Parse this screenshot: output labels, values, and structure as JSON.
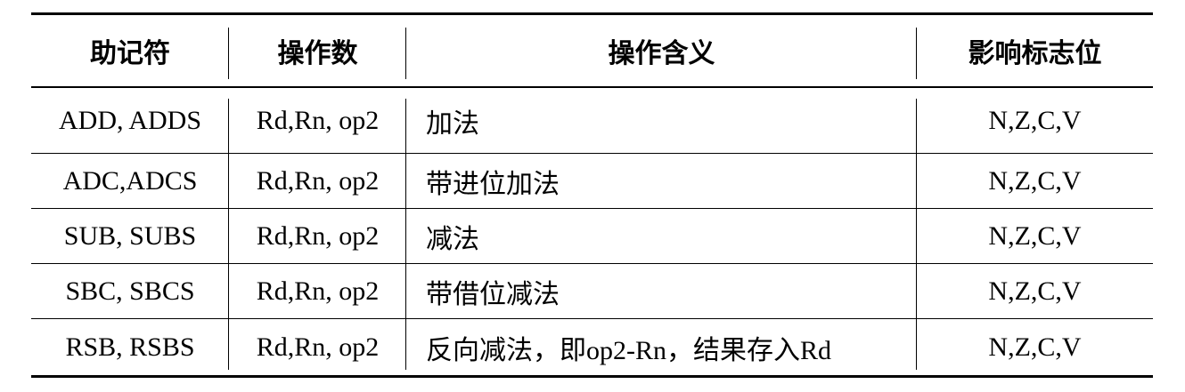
{
  "table": {
    "headers": [
      "助记符",
      "操作数",
      "操作含义",
      "影响标志位"
    ],
    "rows": [
      [
        "ADD, ADDS",
        "Rd,Rn, op2",
        "加法",
        "N,Z,C,V"
      ],
      [
        "ADC,ADCS",
        "Rd,Rn, op2",
        "带进位加法",
        "N,Z,C,V"
      ],
      [
        "SUB, SUBS",
        "Rd,Rn, op2",
        "减法",
        "N,Z,C,V"
      ],
      [
        "SBC, SBCS",
        "Rd,Rn, op2",
        "带借位减法",
        "N,Z,C,V"
      ],
      [
        "RSB, RSBS",
        "Rd,Rn, op2",
        "反向减法，即op2-Rn，结果存入Rd",
        "N,Z,C,V"
      ]
    ]
  }
}
